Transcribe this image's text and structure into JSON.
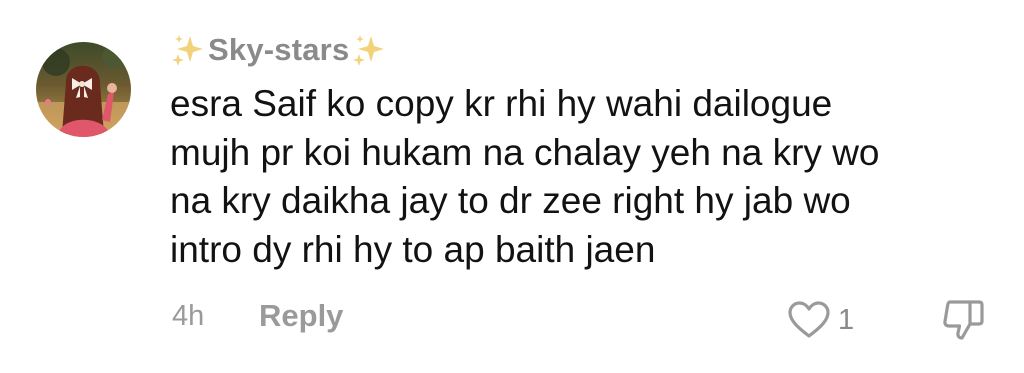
{
  "comment": {
    "username": "Sky-stars",
    "username_decoration_icon": "sparkles-icon",
    "avatar_icon": "profile-avatar-girl-with-bow",
    "text": "esra Saif ko copy kr rhi hy wahi dailogue\nmujh pr koi hukam na chalay yeh na kry wo\nna kry daikha jay to dr zee right hy jab wo\nintro dy rhi hy to ap baith jaen",
    "timestamp": "4h",
    "reply_label": "Reply",
    "like_count": "1",
    "like_icon": "heart-outline-icon",
    "dislike_icon": "thumbs-down-outline-icon"
  },
  "colors": {
    "text_primary": "#121212",
    "text_secondary": "#9a9a9a",
    "sparkle": "#f2d27a",
    "background": "#ffffff"
  }
}
